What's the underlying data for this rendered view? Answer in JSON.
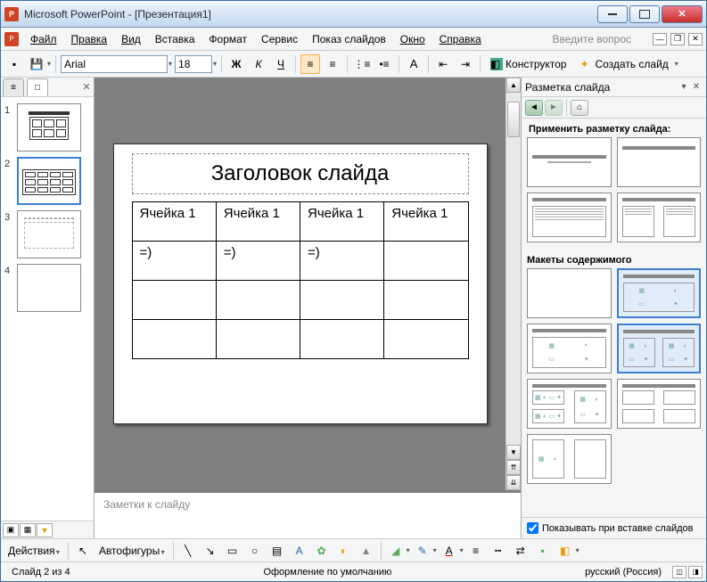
{
  "titlebar": {
    "title": "Microsoft PowerPoint - [Презентация1]"
  },
  "menu": {
    "file": "Файл",
    "edit": "Правка",
    "view": "Вид",
    "insert": "Вставка",
    "format": "Формат",
    "tools": "Сервис",
    "slideshow": "Показ слайдов",
    "window": "Окно",
    "help": "Справка",
    "ask": "Введите вопрос"
  },
  "toolbar": {
    "font": "Arial",
    "size": "18",
    "designer": "Конструктор",
    "newslide": "Создать слайд"
  },
  "thumbs": [
    {
      "num": "1"
    },
    {
      "num": "2"
    },
    {
      "num": "3"
    },
    {
      "num": "4"
    }
  ],
  "slide": {
    "title": "Заголовок слайда",
    "table": [
      [
        "Ячейка 1",
        "Ячейка 1",
        "Ячейка 1",
        "Ячейка 1"
      ],
      [
        "=)",
        "=)",
        "=)",
        ""
      ],
      [
        "",
        "",
        "",
        ""
      ],
      [
        "",
        "",
        "",
        ""
      ]
    ]
  },
  "notes": {
    "placeholder": "Заметки к слайду"
  },
  "taskpane": {
    "title": "Разметка слайда",
    "apply": "Применить разметку слайда:",
    "section2": "Макеты содержимого",
    "show_on_insert": "Показывать при вставке слайдов"
  },
  "bottombar": {
    "actions": "Действия",
    "autoshapes": "Автофигуры"
  },
  "status": {
    "slide": "Слайд 2 из 4",
    "design": "Оформление по умолчанию",
    "lang": "русский (Россия)"
  }
}
